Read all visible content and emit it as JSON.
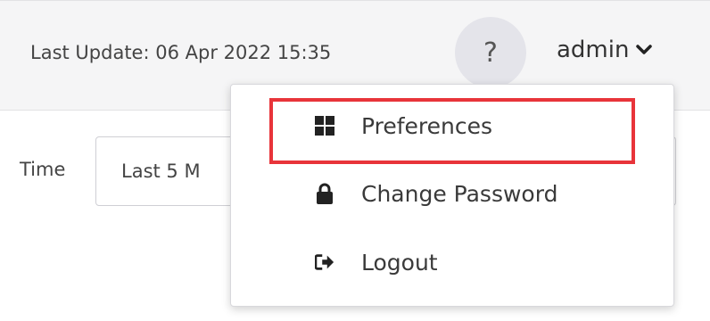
{
  "header": {
    "last_update": "Last Update: 06 Apr 2022 15:35",
    "help_label": "?",
    "user_name": "admin"
  },
  "filters": {
    "time_label": "Time",
    "time_value": "Last 5 M"
  },
  "user_dropdown": {
    "items": [
      {
        "label": "Preferences",
        "icon": "grid-icon"
      },
      {
        "label": "Change Password",
        "icon": "lock-icon"
      },
      {
        "label": "Logout",
        "icon": "logout-icon"
      }
    ],
    "highlighted_item": "Preferences",
    "highlight_color": "#e8343a"
  }
}
